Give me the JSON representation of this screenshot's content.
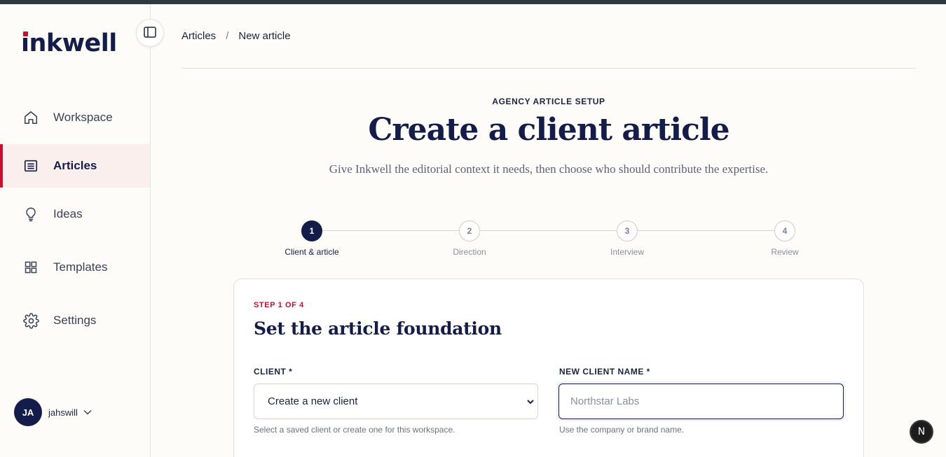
{
  "brand": {
    "logo_text": "inkwell",
    "accent": "#c8102e",
    "navy": "#141d4a"
  },
  "sidebar": {
    "items": [
      {
        "label": "Workspace",
        "icon": "home-icon"
      },
      {
        "label": "Articles",
        "icon": "list-icon",
        "active": true
      },
      {
        "label": "Ideas",
        "icon": "lightbulb-icon"
      },
      {
        "label": "Templates",
        "icon": "grid-icon"
      },
      {
        "label": "Settings",
        "icon": "gear-icon"
      }
    ],
    "user": {
      "initials": "JA",
      "name": "jahswill"
    }
  },
  "breadcrumb": {
    "parent": "Articles",
    "separator": "/",
    "current": "New article"
  },
  "header": {
    "eyebrow": "AGENCY ARTICLE SETUP",
    "title": "Create a client article",
    "subtitle": "Give Inkwell the editorial context it needs, then choose who should contribute the expertise."
  },
  "stepper": {
    "steps": [
      {
        "number": "1",
        "label": "Client & article",
        "active": true
      },
      {
        "number": "2",
        "label": "Direction"
      },
      {
        "number": "3",
        "label": "Interview"
      },
      {
        "number": "4",
        "label": "Review"
      }
    ]
  },
  "form": {
    "step_tag": "STEP 1 OF 4",
    "title": "Set the article foundation",
    "client": {
      "label": "CLIENT *",
      "value": "Create a new client",
      "hint": "Select a saved client or create one for this workspace."
    },
    "new_client": {
      "label": "NEW CLIENT NAME *",
      "placeholder": "Northstar Labs",
      "hint": "Use the company or brand name."
    }
  },
  "fab": {
    "label": "N"
  }
}
